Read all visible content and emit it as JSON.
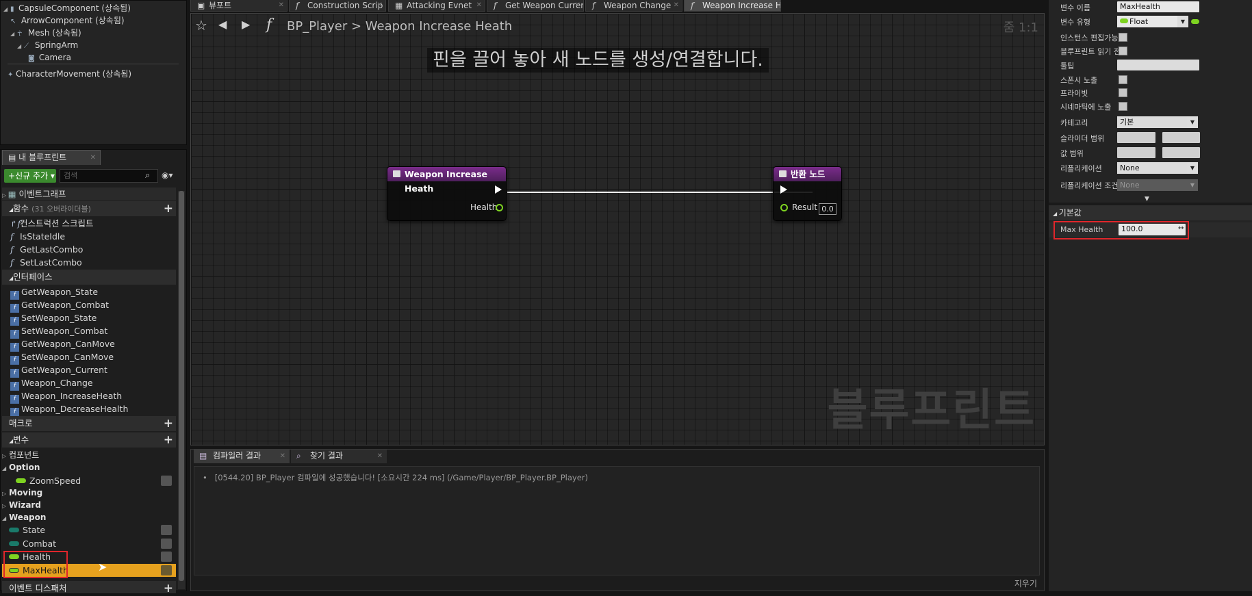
{
  "components": [
    {
      "label": "CapsuleComponent (상속됨)",
      "indent": 0,
      "tri": "◢"
    },
    {
      "label": "ArrowComponent (상속됨)",
      "indent": 1,
      "tri": ""
    },
    {
      "label": "Mesh (상속됨)",
      "indent": 1,
      "tri": "◢"
    },
    {
      "label": "SpringArm",
      "indent": 2,
      "tri": "◢"
    },
    {
      "label": "Camera",
      "indent": 3,
      "tri": ""
    },
    {
      "label": "CharacterMovement (상속됨)",
      "indent": 0,
      "tri": ""
    }
  ],
  "mybp": {
    "tab_label": "내 블루프린트",
    "add_new": "신규 추가",
    "search_placeholder": "검색",
    "event_graph": "이벤트그래프",
    "functions_header": "함수",
    "functions_sub": "(31 오버라이더블)",
    "functions": [
      "컨스트럭션 스크립트",
      "IsStateIdle",
      "GetLastCombo",
      "SetLastCombo"
    ],
    "interface_header": "인터페이스",
    "interfaces": [
      "GetWeapon_State",
      "GetWeapon_Combat",
      "SetWeapon_State",
      "SetWeapon_Combat",
      "GetWeapon_CanMove",
      "SetWeapon_CanMove",
      "GetWeapon_Current",
      "Weapon_Change",
      "Weapon_IncreaseHeath",
      "Weapon_DecreaseHealth"
    ],
    "macro_header": "매크로",
    "variables_header": "변수",
    "var_groups": {
      "component": "컴포넌트",
      "option": "Option",
      "zoom": "ZoomSpeed",
      "moving": "Moving",
      "wizard": "Wizard",
      "weapon": "Weapon",
      "state": "State",
      "combat": "Combat",
      "health": "Health",
      "maxhealth": "MaxHealth"
    },
    "dispatcher_header": "이벤트 디스패처"
  },
  "tabs": [
    {
      "label": "뷰포트",
      "icon": "▣",
      "active": false
    },
    {
      "label": "Construction Scrip",
      "icon": "f",
      "active": false
    },
    {
      "label": "Attacking Evnet",
      "icon": "▦",
      "active": false
    },
    {
      "label": "Get Weapon Currer",
      "icon": "f",
      "active": false
    },
    {
      "label": "Weapon Change",
      "icon": "f",
      "active": false
    },
    {
      "label": "Weapon Increase H",
      "icon": "f",
      "active": true
    }
  ],
  "graph": {
    "bp_name": "BP_Player",
    "sep": ">",
    "func_name": "Weapon Increase Heath",
    "zoom": "줌 1:1",
    "hint": "핀을 끌어 놓아 새 노드를 생성/연결합니다.",
    "watermark": "블루프린트",
    "entry_node": {
      "title": "Weapon Increase Heath",
      "pin": "Health"
    },
    "return_node": {
      "title": "반환 노드",
      "pin": "Result",
      "value": "0.0"
    }
  },
  "log": {
    "tab1": "컴파일러 결과",
    "tab2": "찾기 결과",
    "line": "[0544.20] BP_Player 컴파일에 성공했습니다! [소요시간 224 ms] (/Game/Player/BP_Player.BP_Player)",
    "clear": "지우기"
  },
  "details": {
    "var_name_label": "변수 이름",
    "var_name_value": "MaxHealth",
    "var_type_label": "변수 유형",
    "var_type_value": "Float",
    "instance_editable": "인스턴스 편집가능",
    "bp_readonly": "블루프린트 읽기 전",
    "tooltip": "툴팁",
    "expose_spawn": "스폰시 노출",
    "private": "프라이빗",
    "expose_cinematic": "시네마틱에 노출",
    "category_label": "카테고리",
    "category_value": "기본",
    "slider_range": "슬라이더 범위",
    "value_range": "값 범위",
    "replication_label": "리플리케이션",
    "replication_value": "None",
    "rep_condition_label": "리플리케이션 조건",
    "rep_condition_value": "None",
    "default_section": "기본값",
    "max_health_label": "Max Health",
    "max_health_value": "100.0"
  },
  "colors": {
    "float_pin": "#7ed321",
    "selected_row": "#e6a11e",
    "bool_var": "#b80000",
    "struct_var": "#1a9a7a",
    "red_highlight": "#e0262b"
  }
}
